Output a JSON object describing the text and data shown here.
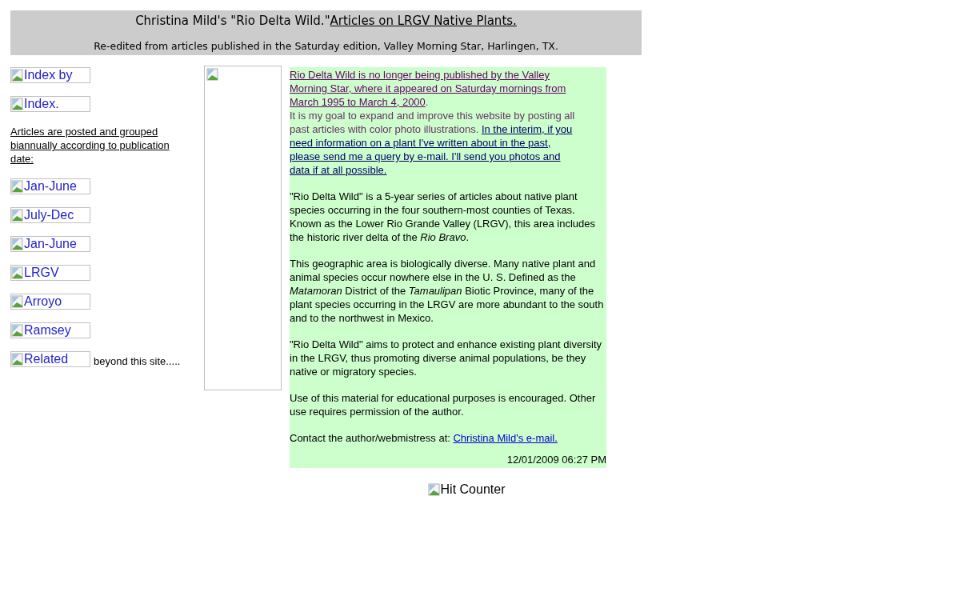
{
  "header": {
    "title": "Christina Mild's \"Rio Delta Wild.\"",
    "title_link": "Articles on LRGV Native Plants.",
    "subtitle": "Re-edited from articles published in the Saturday edition, Valley Morning Star, Harlingen, TX."
  },
  "sidebar": {
    "items": [
      {
        "kind": "image-link",
        "alt": "Index by"
      },
      {
        "kind": "image-link",
        "alt": "Index."
      },
      {
        "kind": "note",
        "text": "Articles are posted and grouped biannually according to publication date:"
      },
      {
        "kind": "image-link",
        "alt": "Jan-June"
      },
      {
        "kind": "image-link",
        "alt": "July-Dec"
      },
      {
        "kind": "image-link",
        "alt": "Jan-June"
      },
      {
        "kind": "image-link",
        "alt": "LRGV"
      },
      {
        "kind": "image-link",
        "alt": "Arroyo"
      },
      {
        "kind": "image-link",
        "alt": "Ramsey"
      },
      {
        "kind": "image-link",
        "alt": "Related",
        "after": "beyond this site....."
      }
    ]
  },
  "content": {
    "intro": [
      [
        {
          "kind": "visited-link",
          "text": "Rio Delta Wild is no longer being published by the Valley"
        }
      ],
      [
        {
          "kind": "visited-link",
          "text": "Morning Star, where it appeared on Saturday mornings from"
        }
      ],
      [
        {
          "kind": "visited-link",
          "text": "March 1995 to March 4, 2000"
        },
        {
          "kind": "text",
          "text": "."
        }
      ],
      [
        {
          "kind": "text",
          "text": "It is my goal to expand and improve this website by posting all"
        }
      ],
      [
        {
          "kind": "text",
          "text": "past articles with color photo illustrations. "
        },
        {
          "kind": "link",
          "text": "In the interim, if you"
        }
      ],
      [
        {
          "kind": "link",
          "text": "need information on a plant I've written about in the past,"
        }
      ],
      [
        {
          "kind": "link",
          "text": "please send me a query by e-mail. I'll send you photos and"
        }
      ],
      [
        {
          "kind": "link",
          "text": "data if at all possible."
        }
      ]
    ],
    "paragraphs": [
      "\"Rio Delta Wild\" is a 5-year series of articles about native plant species occurring in the four southern-most counties of Texas. Known as the Lower Rio Grande Valley (LRGV), this area includes the historic river delta of the *Rio Bravo*.",
      "This geographic area is biologically diverse. Many native plant and animal species occur nowhere else in the U. S. Defined as the *Matamoran* District of the *Tamaulipan* Biotic Province, many of the plant species occurring in the LRGV are more abundant to the south and to the northwest in Mexico.",
      "\"Rio Delta Wild\" aims to protect and enhance existing plant diversity in the LRGV, thus promoting diverse animal populations, be they native or migratory species.",
      "Use of this material for educational purposes is encouraged. Other use requires permission of the author."
    ],
    "contact": {
      "text": "Contact the author/webmistress at: ",
      "link": "Christina Mild's e-mail."
    },
    "timestamp": "12/01/2009 06:27 PM"
  },
  "footer": {
    "alt": "Hit Counter"
  }
}
